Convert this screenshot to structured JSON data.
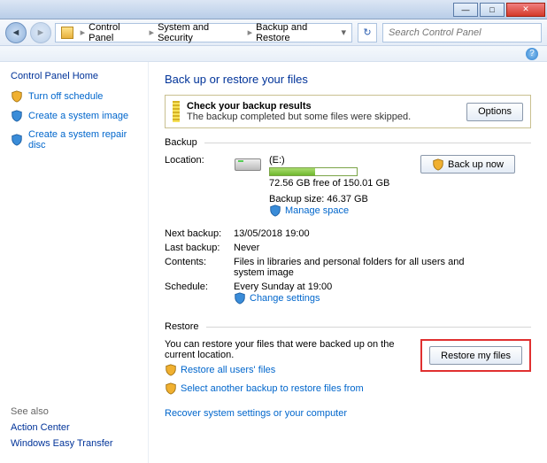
{
  "titlebar": {
    "min": "—",
    "max": "□",
    "close": "✕"
  },
  "nav": {
    "breadcrumb": [
      "Control Panel",
      "System and Security",
      "Backup and Restore"
    ],
    "search_placeholder": "Search Control Panel"
  },
  "sidebar": {
    "home": "Control Panel Home",
    "links": [
      "Turn off schedule",
      "Create a system image",
      "Create a system repair disc"
    ],
    "seealso_label": "See also",
    "seealso": [
      "Action Center",
      "Windows Easy Transfer"
    ]
  },
  "page_title": "Back up or restore your files",
  "alert": {
    "title": "Check your backup results",
    "sub": "The backup completed but some files were skipped.",
    "options_btn": "Options"
  },
  "backup": {
    "legend": "Backup",
    "backup_now_btn": "Back up now",
    "location_label": "Location:",
    "location_value": "(E:)",
    "free_space": "72.56 GB free of 150.01 GB",
    "used_pct": 52,
    "backup_size": "Backup size: 46.37 GB",
    "manage_space": "Manage space",
    "rows": {
      "next_label": "Next backup:",
      "next_val": "13/05/2018 19:00",
      "last_label": "Last backup:",
      "last_val": "Never",
      "contents_label": "Contents:",
      "contents_val": "Files in libraries and personal folders for all users and system image",
      "schedule_label": "Schedule:",
      "schedule_val": "Every Sunday at 19:00"
    },
    "change_settings": "Change settings"
  },
  "restore": {
    "legend": "Restore",
    "text": "You can restore your files that were backed up on the current location.",
    "restore_btn": "Restore my files",
    "restore_all": "Restore all users' files",
    "select_another": "Select another backup to restore files from",
    "recover": "Recover system settings or your computer"
  }
}
